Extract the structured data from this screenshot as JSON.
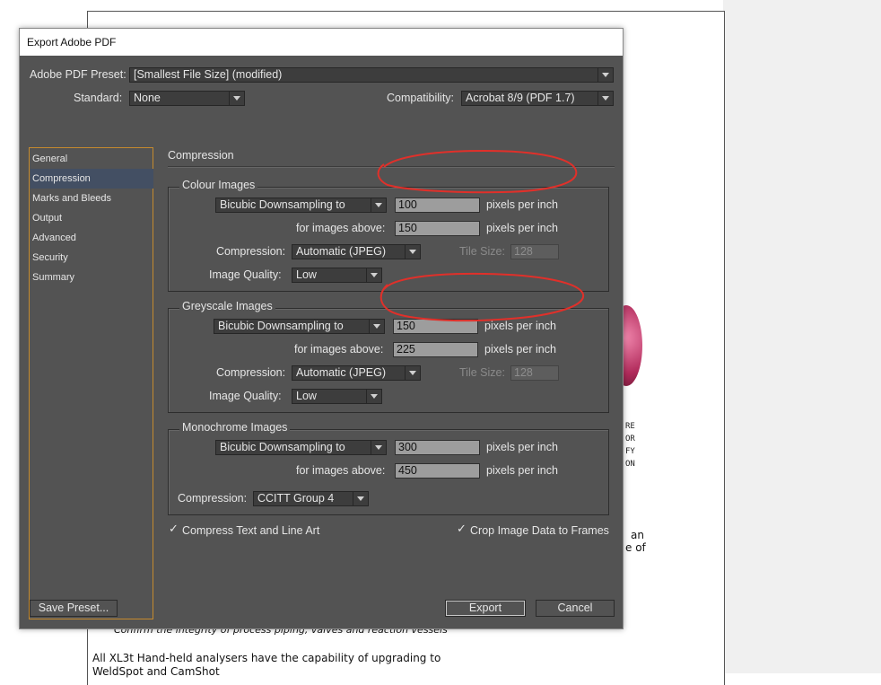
{
  "background": {
    "doc_lines": [
      "Confirm the integrity of process piping, valves and reaction vessels",
      "All XL3t Hand-held analysers have the capability of upgrading to",
      "WeldSpot and CamShot"
    ],
    "side_fragments": [
      "an",
      "e of"
    ],
    "side_caps": "RE\nOR\nFY\nON"
  },
  "dialog": {
    "title": "Export Adobe PDF",
    "preset_label": "Adobe PDF Preset:",
    "preset_value": "[Smallest File Size] (modified)",
    "standard_label": "Standard:",
    "standard_value": "None",
    "compat_label": "Compatibility:",
    "compat_value": "Acrobat 8/9 (PDF 1.7)"
  },
  "sidebar": {
    "items": [
      {
        "label": "General"
      },
      {
        "label": "Compression"
      },
      {
        "label": "Marks and Bleeds"
      },
      {
        "label": "Output"
      },
      {
        "label": "Advanced"
      },
      {
        "label": "Security"
      },
      {
        "label": "Summary"
      }
    ],
    "active_index": 1
  },
  "compression": {
    "title": "Compression",
    "colour": {
      "title": "Colour Images",
      "sampling": "Bicubic Downsampling to",
      "ppi": "100",
      "ppi_unit": "pixels per inch",
      "above_label": "for images above:",
      "above": "150",
      "above_unit": "pixels per inch",
      "compression_label": "Compression:",
      "compression": "Automatic (JPEG)",
      "tile_label": "Tile Size:",
      "tile": "128",
      "quality_label": "Image Quality:",
      "quality": "Low"
    },
    "greyscale": {
      "title": "Greyscale Images",
      "sampling": "Bicubic Downsampling to",
      "ppi": "150",
      "ppi_unit": "pixels per inch",
      "above_label": "for images above:",
      "above": "225",
      "above_unit": "pixels per inch",
      "compression_label": "Compression:",
      "compression": "Automatic (JPEG)",
      "tile_label": "Tile Size:",
      "tile": "128",
      "quality_label": "Image Quality:",
      "quality": "Low"
    },
    "mono": {
      "title": "Monochrome Images",
      "sampling": "Bicubic Downsampling to",
      "ppi": "300",
      "ppi_unit": "pixels per inch",
      "above_label": "for images above:",
      "above": "450",
      "above_unit": "pixels per inch",
      "compression_label": "Compression:",
      "compression": "CCITT Group 4"
    },
    "compress_text_label": "Compress Text and Line Art",
    "crop_label": "Crop Image Data to Frames"
  },
  "buttons": {
    "save_preset": "Save Preset...",
    "export": "Export",
    "cancel": "Cancel"
  },
  "colors": {
    "annotation": "#e0302a",
    "sidebar_border": "#c58a2e",
    "dialog_bg": "#535353"
  }
}
